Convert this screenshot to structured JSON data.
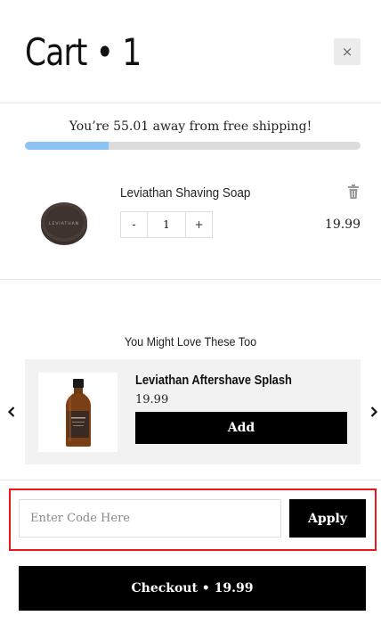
{
  "header": {
    "title": "Cart • 1",
    "close_label": "×"
  },
  "shipping": {
    "message": "You’re 55.01 away from free shipping!",
    "progress_fraction": 0.25
  },
  "cart_item": {
    "name": "Leviathan Shaving Soap",
    "quantity": "1",
    "decrement_label": "-",
    "increment_label": "+",
    "price": "19.99",
    "image_icon": "shaving-soap-tin",
    "image_text": "LEVIATHAN"
  },
  "recommendations": {
    "heading": "You Might Love These Too",
    "items": [
      {
        "name": "Leviathan Aftershave Splash",
        "price": "19.99",
        "add_label": "Add",
        "image_icon": "amber-bottle"
      }
    ],
    "prev_icon": "chevron-left-icon",
    "next_icon": "chevron-right-icon"
  },
  "discount": {
    "placeholder": "Enter Code Here",
    "value": "",
    "apply_label": "Apply",
    "highlight_color": "#e8161b"
  },
  "checkout": {
    "label": "Checkout • 19.99"
  },
  "colors": {
    "progress_fill": "#8cc3f4",
    "progress_track": "#dcdcdc",
    "button_bg": "#000000",
    "card_bg": "#f2f2f2"
  }
}
